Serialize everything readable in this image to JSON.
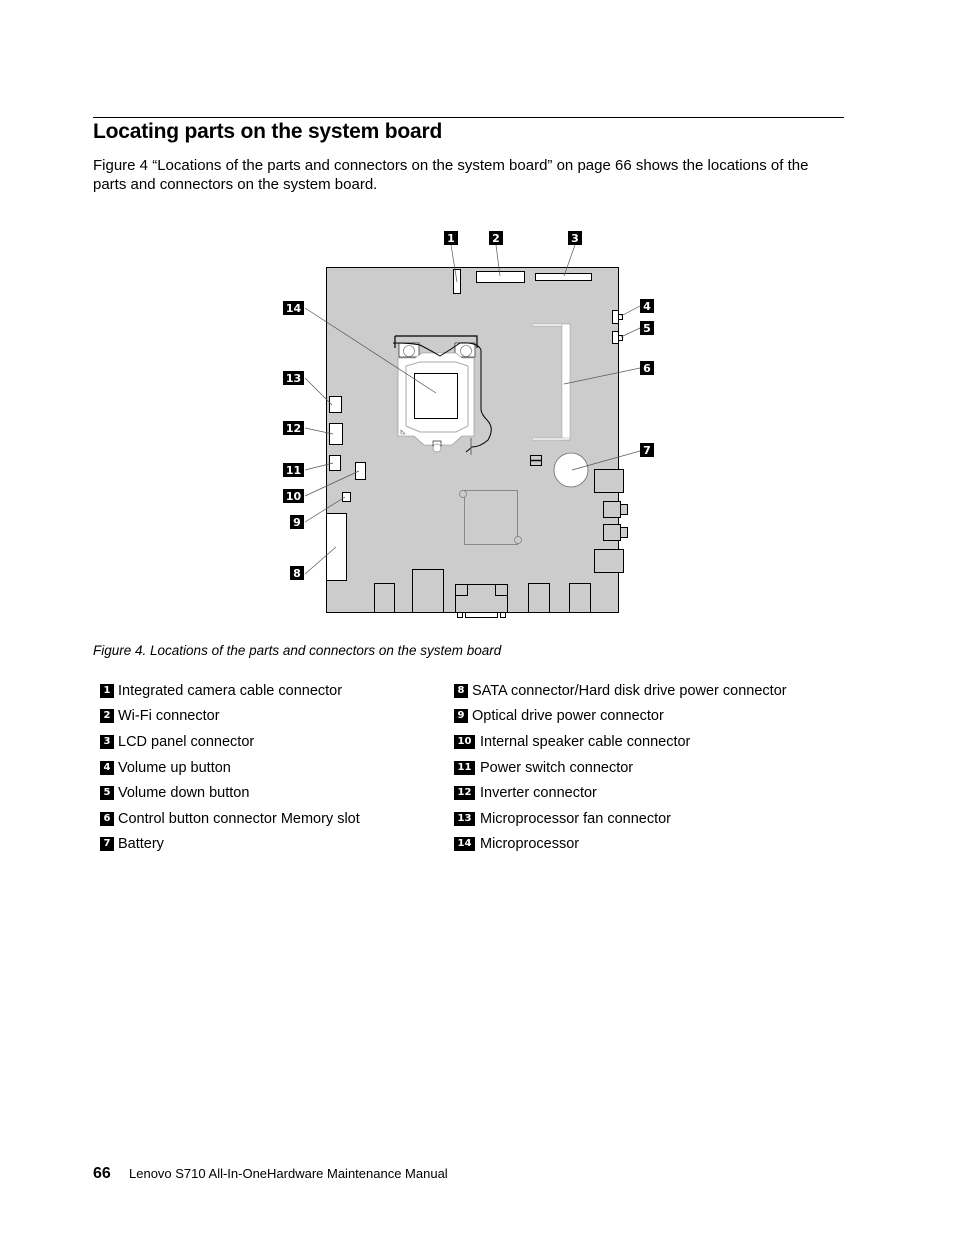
{
  "section": {
    "title": "Locating parts on the system board",
    "intro": "Figure 4 “Locations of the parts and connectors on the system board” on page 66 shows the locations of the parts and connectors on the system board."
  },
  "figure": {
    "caption": "Figure 4.  Locations of the parts and connectors on the system board",
    "board_color": "#cccccc",
    "callouts": [
      "1",
      "2",
      "3",
      "4",
      "5",
      "6",
      "7",
      "8",
      "9",
      "10",
      "11",
      "12",
      "13",
      "14"
    ]
  },
  "legend": {
    "left": [
      {
        "num": "1",
        "label": "Integrated camera cable connector"
      },
      {
        "num": "2",
        "label": "Wi-Fi connector"
      },
      {
        "num": "3",
        "label": "LCD panel connector"
      },
      {
        "num": "4",
        "label": "Volume up button"
      },
      {
        "num": "5",
        "label": "Volume down button"
      },
      {
        "num": "6",
        "label": "Control button connector Memory slot"
      },
      {
        "num": "7",
        "label": "Battery"
      }
    ],
    "right": [
      {
        "num": "8",
        "label": "SATA connector/Hard disk drive power connector"
      },
      {
        "num": "9",
        "label": "Optical drive power connector"
      },
      {
        "num": "10",
        "label": "Internal speaker cable connector"
      },
      {
        "num": "11",
        "label": "Power switch connector"
      },
      {
        "num": "12",
        "label": "Inverter connector"
      },
      {
        "num": "13",
        "label": "Microprocessor fan connector"
      },
      {
        "num": "14",
        "label": "Microprocessor"
      }
    ]
  },
  "footer": {
    "page_number": "66",
    "text": "Lenovo S710 All-In-OneHardware Maintenance Manual"
  }
}
